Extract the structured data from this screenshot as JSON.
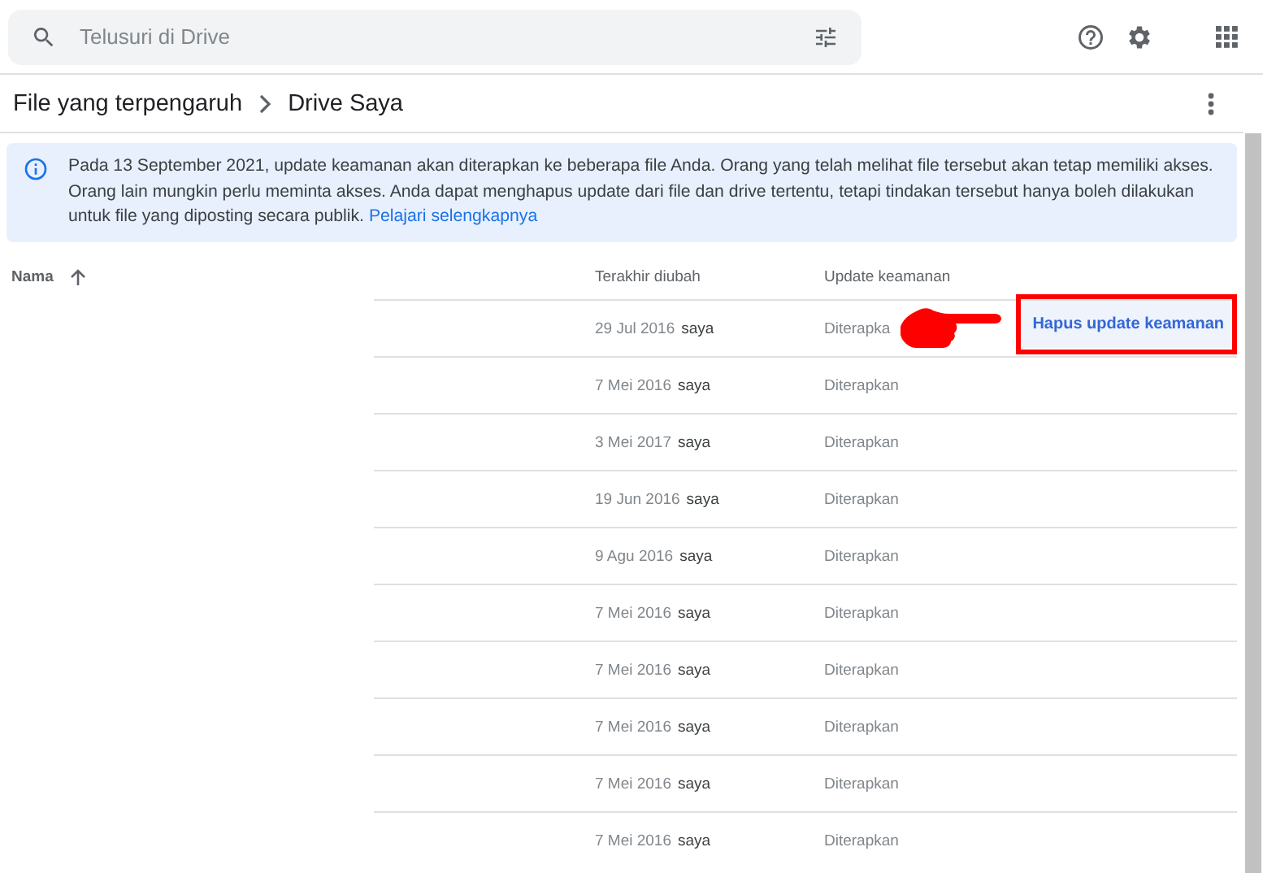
{
  "search": {
    "placeholder": "Telusuri di Drive"
  },
  "breadcrumb": [
    "File yang terpengaruh",
    "Drive Saya"
  ],
  "banner": {
    "text": "Pada 13 September 2021, update keamanan akan diterapkan ke beberapa file Anda. Orang yang telah melihat file tersebut akan tetap memiliki akses. Orang lain mungkin perlu meminta akses. Anda dapat menghapus update dari file dan drive tertentu, tetapi tindakan tersebut hanya boleh dilakukan untuk file yang diposting secara publik.",
    "link": "Pelajari selengkapnya"
  },
  "table": {
    "columns": [
      "Nama",
      "Terakhir diubah",
      "Update keamanan"
    ],
    "rows": [
      {
        "modified": "29 Jul 2016",
        "owner": "saya",
        "status": "Diterapka",
        "action": "Hapus update keamanan"
      },
      {
        "modified": "7 Mei 2016",
        "owner": "saya",
        "status": "Diterapkan"
      },
      {
        "modified": "3 Mei 2017",
        "owner": "saya",
        "status": "Diterapkan"
      },
      {
        "modified": "19 Jun 2016",
        "owner": "saya",
        "status": "Diterapkan"
      },
      {
        "modified": "9 Agu 2016",
        "owner": "saya",
        "status": "Diterapkan"
      },
      {
        "modified": "7 Mei 2016",
        "owner": "saya",
        "status": "Diterapkan"
      },
      {
        "modified": "7 Mei 2016",
        "owner": "saya",
        "status": "Diterapkan"
      },
      {
        "modified": "7 Mei 2016",
        "owner": "saya",
        "status": "Diterapkan"
      },
      {
        "modified": "7 Mei 2016",
        "owner": "saya",
        "status": "Diterapkan"
      },
      {
        "modified": "7 Mei 2016",
        "owner": "saya",
        "status": "Diterapkan"
      }
    ]
  }
}
